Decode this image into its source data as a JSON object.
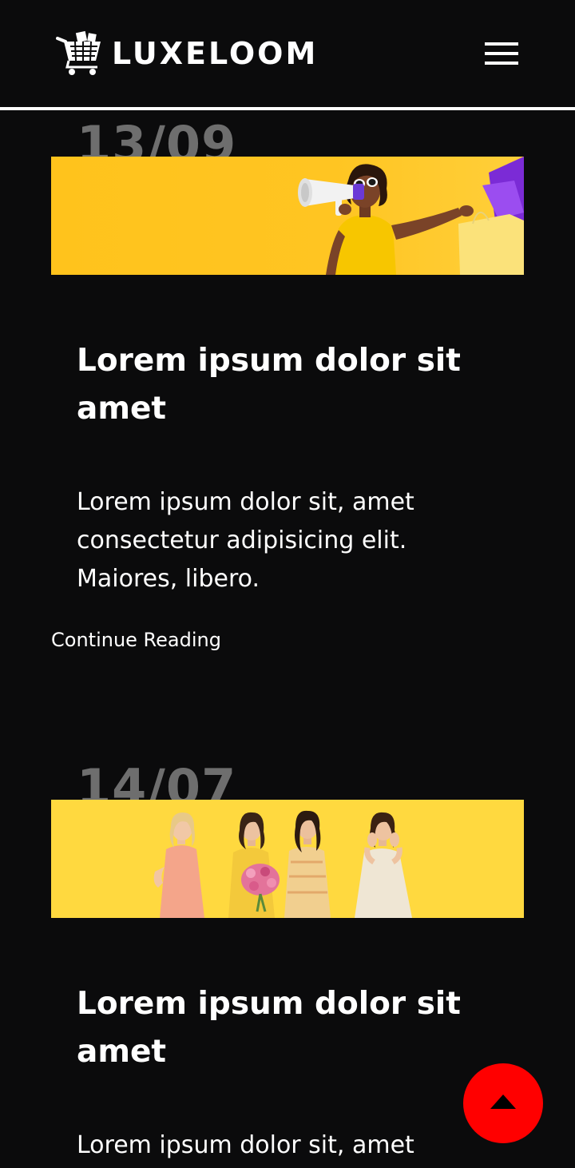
{
  "header": {
    "brand": "LUXELOOM",
    "logo_icon": "shopping-cart-icon",
    "menu_icon": "hamburger-menu-icon"
  },
  "posts": [
    {
      "date": "13/09",
      "title": "Lorem ipsum dolor sit amet",
      "excerpt": "Lorem ipsum dolor sit, amet consectetur adipisicing elit. Maiores, libero.",
      "link": "Continue Reading",
      "image_alt": "woman with megaphone and shopping bags"
    },
    {
      "date": "14/07",
      "title": "Lorem ipsum dolor sit amet",
      "excerpt": "Lorem ipsum dolor sit, amet",
      "image_alt": "four women smiling"
    }
  ],
  "back_to_top": {
    "icon": "arrow-up-icon"
  },
  "colors": {
    "background": "#0b0b0c",
    "banner_yellow": "#ffc21a",
    "accent_red": "#ff0000",
    "date_gray": "#6e6e6e"
  }
}
